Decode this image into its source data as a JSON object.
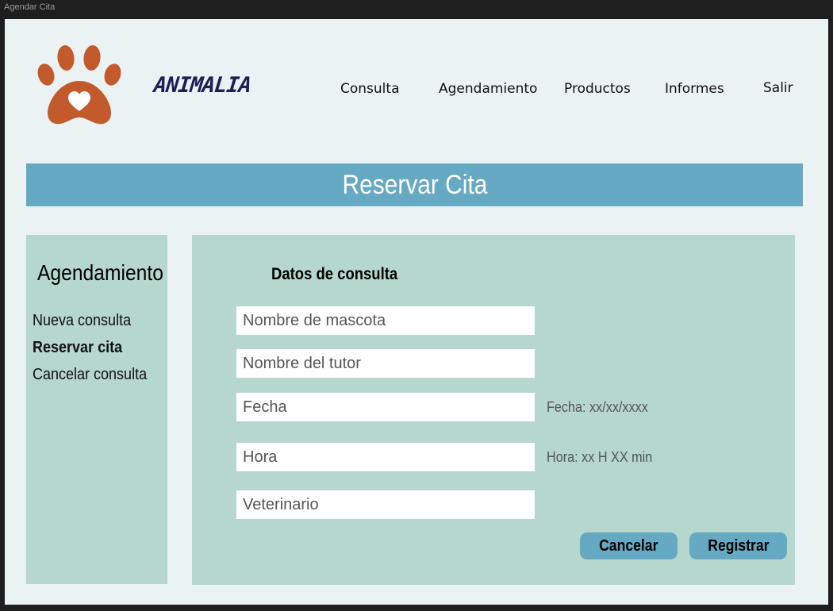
{
  "window": {
    "title": "Agendar Cita"
  },
  "header": {
    "brand": "ANIMALIA",
    "logo_color": "#c25a2c",
    "nav": [
      "Consulta",
      "Agendamiento",
      "Productos",
      "Informes",
      "Salir"
    ]
  },
  "title_bar": {
    "title": "Reservar Cita",
    "color": "#66a9c3"
  },
  "sidebar": {
    "heading": "Agendamiento",
    "items": [
      {
        "label": "Nueva consulta",
        "active": false
      },
      {
        "label": "Reservar cita",
        "active": true
      },
      {
        "label": "Cancelar consulta",
        "active": false
      }
    ],
    "color": "#b5d7cd"
  },
  "form": {
    "section_title": "Datos de consulta",
    "fields": [
      {
        "placeholder": "Nombre de mascota",
        "hint": ""
      },
      {
        "placeholder": "Nombre del tutor",
        "hint": ""
      },
      {
        "placeholder": "Fecha",
        "hint": "Fecha: xx/xx/xxxx"
      },
      {
        "placeholder": "Hora",
        "hint": "Hora: xx H XX min"
      },
      {
        "placeholder": "Veterinario",
        "hint": ""
      }
    ],
    "buttons": {
      "cancel": "Cancelar",
      "submit": "Registrar"
    }
  }
}
